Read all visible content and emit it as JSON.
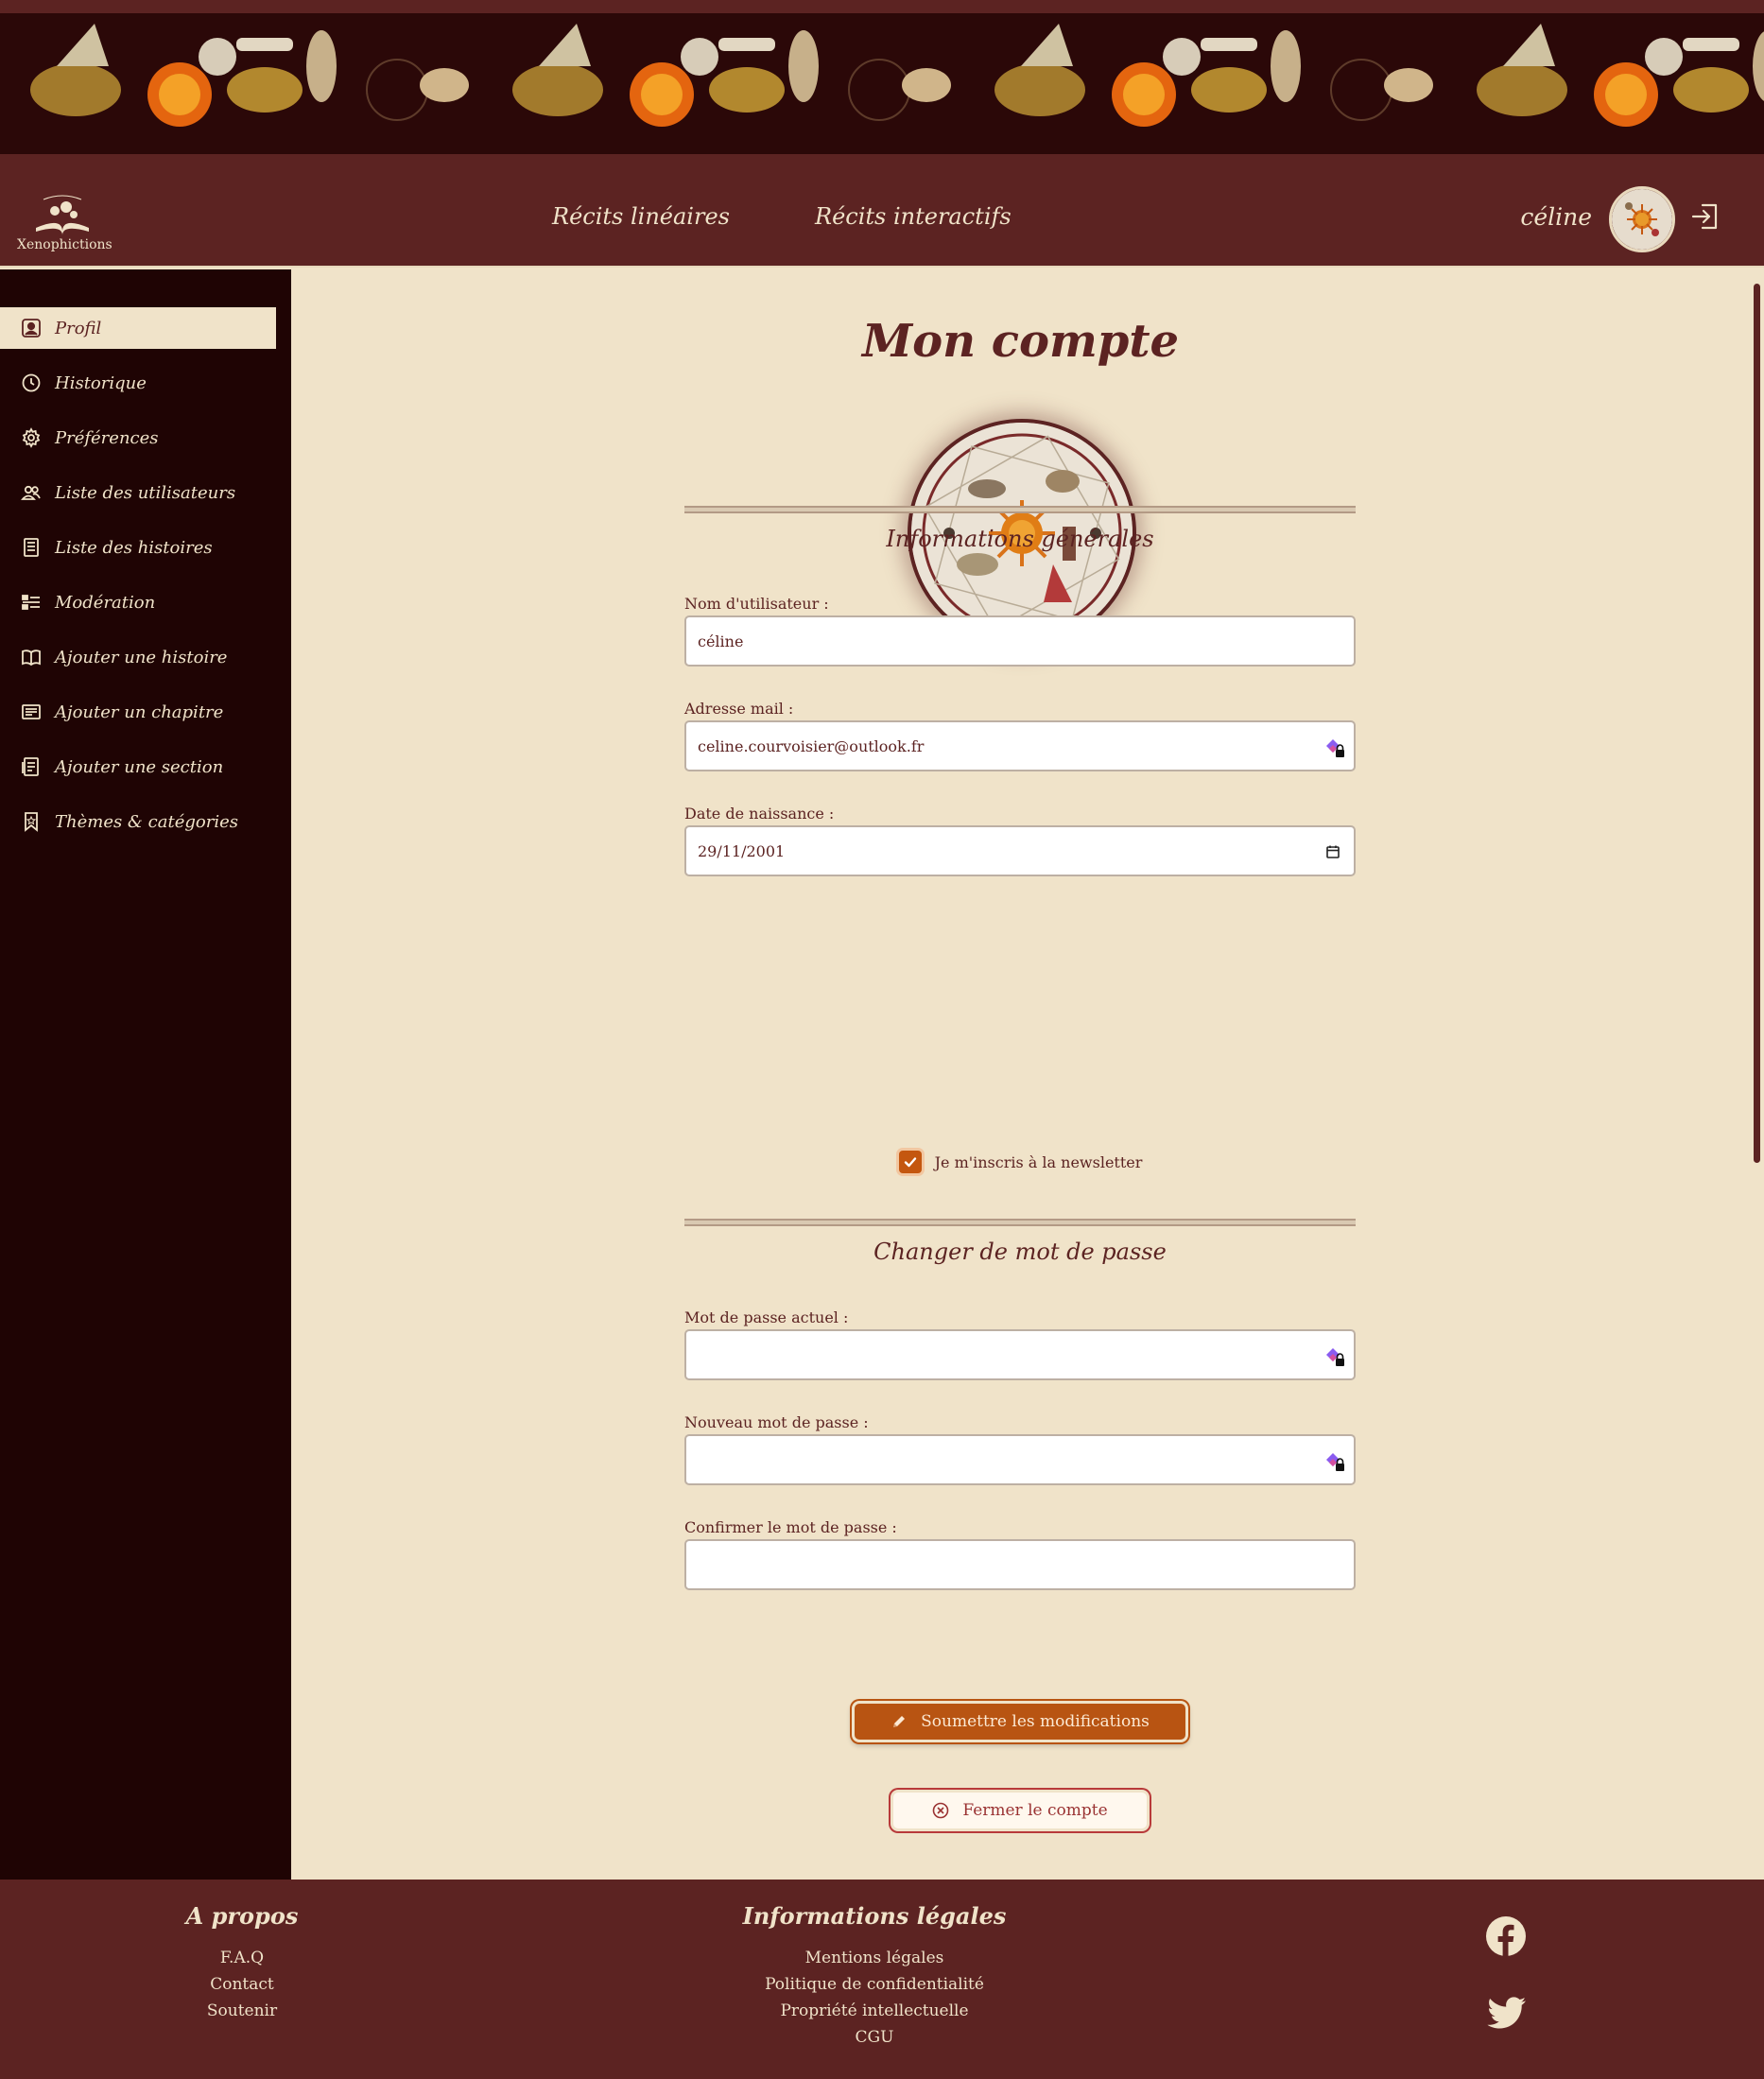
{
  "header": {
    "logo_text": "Xenophictions",
    "nav": [
      "Récits linéaires",
      "Récits interactifs"
    ],
    "user_name": "céline"
  },
  "sidebar": {
    "items": [
      {
        "label": "Profil",
        "icon": "user-icon",
        "active": true
      },
      {
        "label": "Historique",
        "icon": "clock-icon"
      },
      {
        "label": "Préférences",
        "icon": "gear-icon"
      },
      {
        "label": "Liste des utilisateurs",
        "icon": "users-icon"
      },
      {
        "label": "Liste des histoires",
        "icon": "list-icon"
      },
      {
        "label": "Modération",
        "icon": "moderation-icon"
      },
      {
        "label": "Ajouter une histoire",
        "icon": "book-icon"
      },
      {
        "label": "Ajouter un chapitre",
        "icon": "chapter-icon"
      },
      {
        "label": "Ajouter une section",
        "icon": "section-icon"
      },
      {
        "label": "Thèmes & catégories",
        "icon": "bookmark-icon"
      }
    ]
  },
  "main": {
    "title": "Mon compte",
    "general": {
      "title": "Informations générales",
      "username_label": "Nom d'utilisateur :",
      "username_value": "céline",
      "email_label": "Adresse mail :",
      "email_value": "celine.courvoisier@outlook.fr",
      "birthdate_label": "Date de naissance :",
      "birthdate_value": "29/11/2001",
      "newsletter_label": "Je m'inscris à la newsletter",
      "newsletter_checked": true
    },
    "password": {
      "title": "Changer de mot de passe",
      "current_label": "Mot de passe actuel :",
      "new_label": "Nouveau mot de passe :",
      "confirm_label": "Confirmer le mot de passe :"
    },
    "submit_label": "Soumettre les modifications",
    "close_label": "Fermer le compte"
  },
  "footer": {
    "about": {
      "title": "A propos",
      "links": [
        "F.A.Q",
        "Contact",
        "Soutenir"
      ]
    },
    "legal": {
      "title": "Informations légales",
      "links": [
        "Mentions légales",
        "Politique de confidentialité",
        "Propriété intellectuelle",
        "CGU"
      ]
    },
    "social_icons": [
      "facebook-icon",
      "twitter-icon"
    ]
  },
  "colors": {
    "burgundy": "#5c2322",
    "dark_sidebar": "#1f0404",
    "cream": "#f0e3c9",
    "orange_accent": "#b85412",
    "danger": "#b83a3a"
  }
}
